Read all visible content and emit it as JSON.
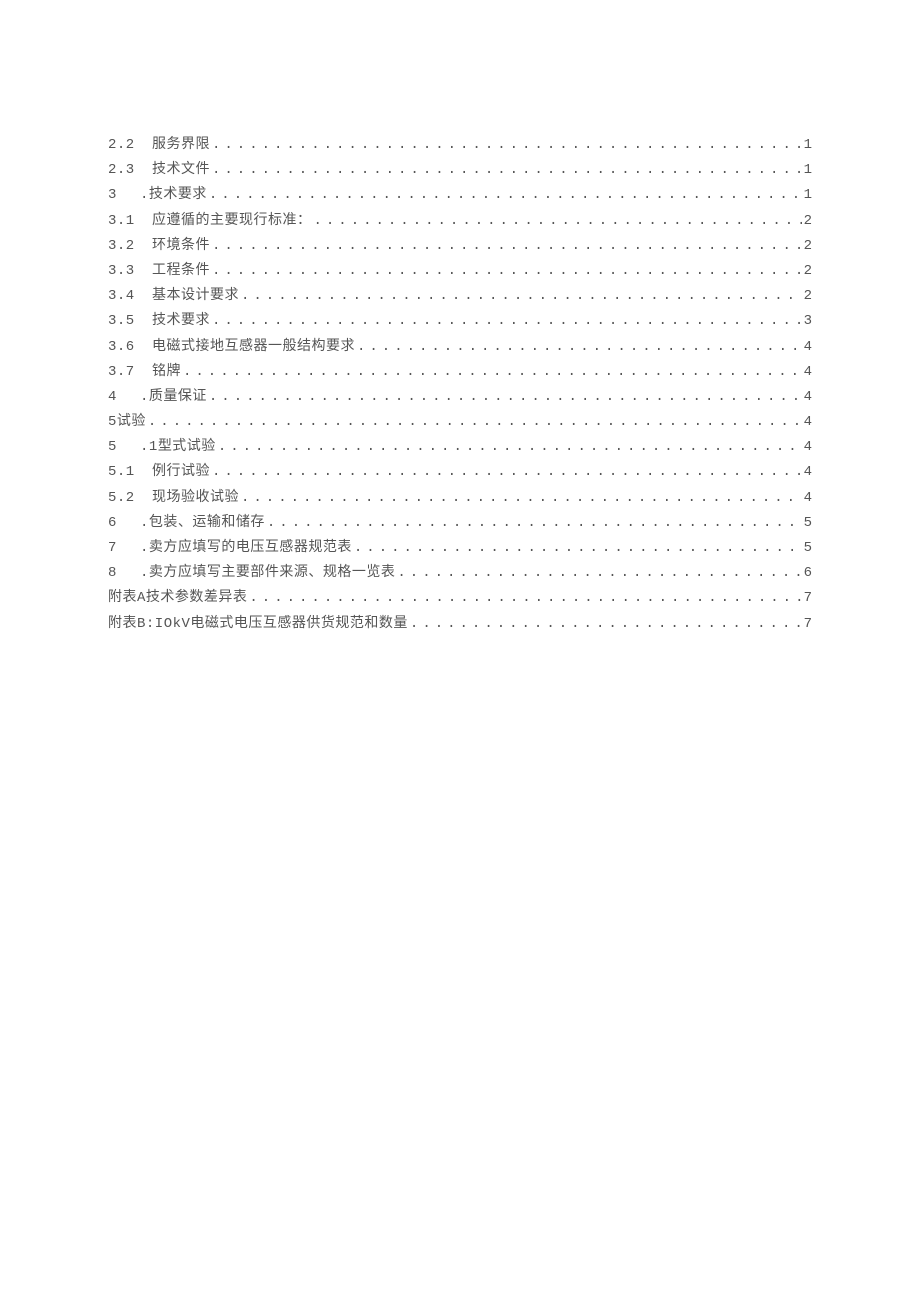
{
  "toc": {
    "entries": [
      {
        "num": "2.2",
        "numClass": "wide",
        "title": "服务界限",
        "page": "1"
      },
      {
        "num": "2.3",
        "numClass": "wide",
        "title": "技术文件",
        "page": "1"
      },
      {
        "num": "3",
        "numClass": "narrow",
        "prefix": ".",
        "title": "技术要求",
        "page": "1"
      },
      {
        "num": "3.1",
        "numClass": "wide",
        "title": "应遵循的主要现行标准：",
        "page": "2"
      },
      {
        "num": "3.2",
        "numClass": "wide",
        "title": "环境条件",
        "page": "2"
      },
      {
        "num": "3.3",
        "numClass": "wide",
        "title": "工程条件",
        "page": "2"
      },
      {
        "num": "3.4",
        "numClass": "wide",
        "title": "基本设计要求",
        "page": "2"
      },
      {
        "num": "3.5",
        "numClass": "wide",
        "title": "技术要求",
        "page": "3"
      },
      {
        "num": "3.6",
        "numClass": "wide",
        "title": "电磁式接地互感器一般结构要求",
        "page": "4"
      },
      {
        "num": "3.7",
        "numClass": "wide",
        "title": "铭牌",
        "page": "4"
      },
      {
        "num": "4",
        "numClass": "narrow",
        "prefix": ".",
        "title": "质量保证",
        "page": "4"
      },
      {
        "num": "5",
        "numClass": "",
        "title": "试验",
        "noIndent": true,
        "page": "4"
      },
      {
        "num": "5",
        "numClass": "narrow",
        "prefix": ".1",
        "title": "型式试验",
        "page": "4"
      },
      {
        "num": "5.1",
        "numClass": "wide",
        "title": "例行试验",
        "page": "4"
      },
      {
        "num": "5.2",
        "numClass": "wide",
        "title": "现场验收试验",
        "page": "4"
      },
      {
        "num": "6",
        "numClass": "narrow",
        "prefix": ".",
        "title": "包装、运输和储存",
        "page": "5"
      },
      {
        "num": "7",
        "numClass": "narrow",
        "prefix": ".",
        "title": "卖方应填写的电压互感器规范表",
        "page": "5"
      },
      {
        "num": "8",
        "numClass": "narrow",
        "prefix": ".",
        "title": "卖方应填写主要部件来源、规格一览表",
        "page": "6"
      },
      {
        "num": "",
        "numClass": "",
        "title": "附表A技术参数差异表",
        "noIndent": true,
        "page": "7"
      },
      {
        "num": "",
        "numClass": "",
        "title": "附表B:IOkV电磁式电压互感器供货规范和数量",
        "noIndent": true,
        "page": "7"
      }
    ]
  }
}
